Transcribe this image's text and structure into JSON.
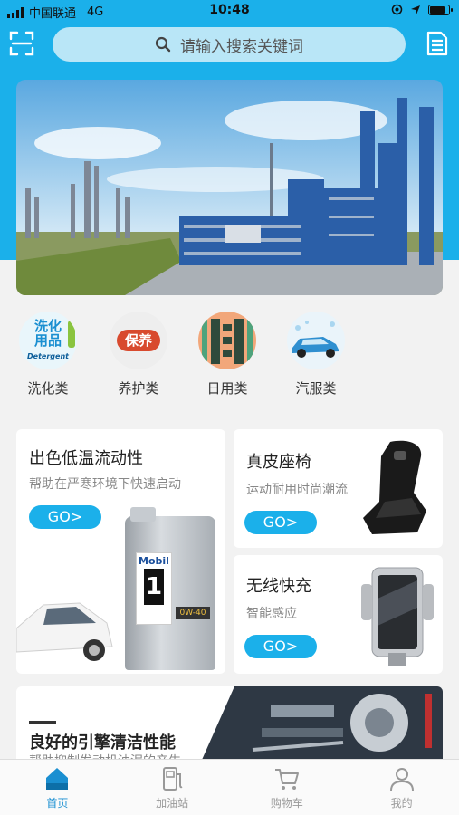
{
  "status": {
    "carrier": "中国联通",
    "network": "4G",
    "time": "10:48"
  },
  "search": {
    "placeholder": "请输入搜索关键词"
  },
  "categories": [
    {
      "label": "洗化类",
      "icon_text_1": "洗化",
      "icon_text_2": "用品",
      "icon_text_3": "Detergent"
    },
    {
      "label": "养护类",
      "icon_text": "保养"
    },
    {
      "label": "日用类"
    },
    {
      "label": "汽服类"
    }
  ],
  "promos": {
    "oil": {
      "title": "出色低温流动性",
      "subtitle": "帮助在严寒环境下快速启动",
      "button": "GO>",
      "brand": "Mobil",
      "grade": "1",
      "viscosity": "0W-40"
    },
    "seat": {
      "title": "真皮座椅",
      "subtitle": "运动耐用时尚潮流",
      "button": "GO>"
    },
    "charger": {
      "title": "无线快充",
      "subtitle": "智能感应",
      "button": "GO>"
    },
    "engine": {
      "title": "良好的引擎清洁性能",
      "subtitle": "帮助抑制发动机油泥的产生"
    }
  },
  "tabs": [
    {
      "label": "首页",
      "icon": "home-icon",
      "active": true
    },
    {
      "label": "加油站",
      "icon": "fuel-station-icon",
      "active": false
    },
    {
      "label": "购物车",
      "icon": "cart-icon",
      "active": false
    },
    {
      "label": "我的",
      "icon": "user-icon",
      "active": false
    }
  ],
  "colors": {
    "accent": "#1bb0ea",
    "active_tab": "#1a8fd1"
  }
}
